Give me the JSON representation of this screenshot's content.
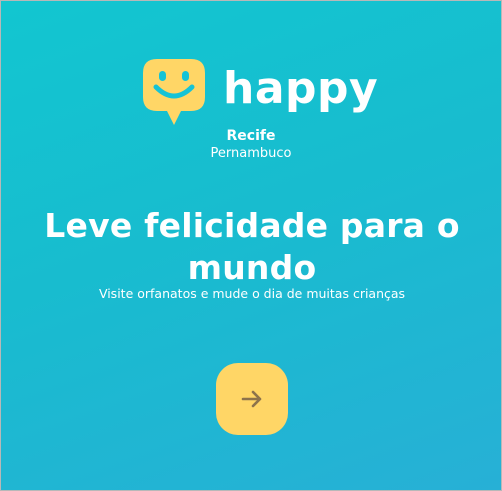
{
  "brand": {
    "name": "happy",
    "logo_icon": "smiling-chat-bubble-icon",
    "logo_color": "#ffd666"
  },
  "location": {
    "city": "Recife",
    "state": "Pernambuco"
  },
  "hero": {
    "headline": "Leve felicidade para o mundo",
    "subtitle": "Visite orfanatos e mude o dia de muitas crianças"
  },
  "enter_button": {
    "icon": "arrow-right-icon",
    "background_color": "#ffd666",
    "icon_color": "#8d734b"
  },
  "colors": {
    "background_start": "#12c6d0",
    "background_end": "#27b0d6",
    "text": "#ffffff"
  }
}
